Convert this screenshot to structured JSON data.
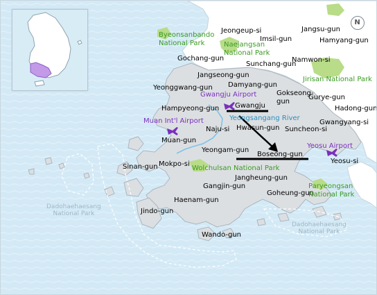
{
  "map": {
    "compass": "N",
    "regions": [
      {
        "id": "jeongeup",
        "text": "Jeongeup-si",
        "cls": "muted"
      },
      {
        "id": "jangsu",
        "text": "Jangsu-gun",
        "cls": "muted"
      },
      {
        "id": "imsil",
        "text": "Imsil-gun",
        "cls": "muted"
      },
      {
        "id": "hamyang",
        "text": "Hamyang-gun",
        "cls": "muted"
      },
      {
        "id": "gochang",
        "text": "Gochang-gun",
        "cls": "muted"
      },
      {
        "id": "sunchang",
        "text": "Sunchang-gun",
        "cls": "muted"
      },
      {
        "id": "namwon",
        "text": "Namwon-si",
        "cls": "muted"
      },
      {
        "id": "hadong",
        "text": "Hadong-gun",
        "cls": "muted"
      },
      {
        "id": "jangseong",
        "text": "Jangseong-gun",
        "cls": "city"
      },
      {
        "id": "yeonggwang",
        "text": "Yeonggwang-gun",
        "cls": "city"
      },
      {
        "id": "damyang",
        "text": "Damyang-gun",
        "cls": "city"
      },
      {
        "id": "gokseong",
        "text": "Gokseong-\ngun",
        "cls": "city"
      },
      {
        "id": "gurye",
        "text": "Gurye-gun",
        "cls": "city"
      },
      {
        "id": "gwangju",
        "text": "Gwangju",
        "cls": "city under"
      },
      {
        "id": "hampyeong",
        "text": "Hampyeong-gun",
        "cls": "city"
      },
      {
        "id": "naju",
        "text": "Naju-si",
        "cls": "city"
      },
      {
        "id": "hwasun",
        "text": "Hwasun-gun",
        "cls": "city"
      },
      {
        "id": "suncheon",
        "text": "Suncheon-si",
        "cls": "city"
      },
      {
        "id": "gwangyang",
        "text": "Gwangyang-si",
        "cls": "city"
      },
      {
        "id": "muan",
        "text": "Muan-gun",
        "cls": "city"
      },
      {
        "id": "yeongam",
        "text": "Yeongam-gun",
        "cls": "city"
      },
      {
        "id": "boseong",
        "text": "Boseong-gun",
        "cls": "city under"
      },
      {
        "id": "yeosu",
        "text": "Yeosu-si",
        "cls": "city"
      },
      {
        "id": "sinan",
        "text": "Sinan-gun",
        "cls": "city"
      },
      {
        "id": "mokpo",
        "text": "Mokpo-si",
        "cls": "city"
      },
      {
        "id": "jangheung",
        "text": "Jangheung-gun",
        "cls": "city"
      },
      {
        "id": "gangjin",
        "text": "Gangjin-gun",
        "cls": "city"
      },
      {
        "id": "goheung",
        "text": "Goheung-gun",
        "cls": "city"
      },
      {
        "id": "haenam",
        "text": "Haenam-gun",
        "cls": "city"
      },
      {
        "id": "jindo",
        "text": "Jindo-gun",
        "cls": "city"
      },
      {
        "id": "wando",
        "text": "Wando-gun",
        "cls": "city"
      }
    ],
    "parks": [
      {
        "id": "byeonsan",
        "text": "Byeonsanbando\nNational Park"
      },
      {
        "id": "naejangsan",
        "text": "Naejangsan\nNational Park"
      },
      {
        "id": "jirisan",
        "text": "Jirisan National Park"
      },
      {
        "id": "wolchulsan",
        "text": "Wolchulsan National Park"
      },
      {
        "id": "paryeongsan",
        "text": "Paryeongsan\nNational Park"
      }
    ],
    "water": [
      {
        "id": "yeongsangang",
        "text": "Yeongsangang River"
      }
    ],
    "airports": [
      {
        "id": "gwangju-airport",
        "text": "Gwangju Airport"
      },
      {
        "id": "muan-airport",
        "text": "Muan Int'l Airport"
      },
      {
        "id": "yeosu-airport",
        "text": "Yeosu Airport"
      }
    ],
    "sea_parks": [
      {
        "id": "dadohae-west",
        "text": "Dadohaehaesang\nNational Park"
      },
      {
        "id": "dadohae-south",
        "text": "Dadohaehaesang\nNational Park"
      }
    ],
    "colors": {
      "sea": "#d3eaf6",
      "land": "#dcdfe2",
      "outer_land": "#ffffff",
      "park_area": "#b8dc88",
      "route": "#000000",
      "airport": "#7a2fbd",
      "inset_highlight": "#c39ae8"
    },
    "annotation": {
      "from": "Gwangju",
      "to": "Boseong-gun",
      "type": "arrow"
    },
    "inset_icon": "korea-peninsula-locator"
  }
}
